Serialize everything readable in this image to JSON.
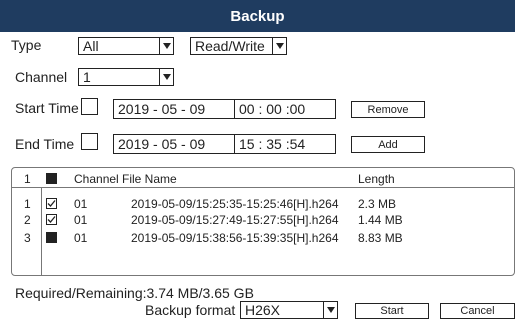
{
  "window": {
    "title": "Backup"
  },
  "filters": {
    "type_label": "Type",
    "type_value": "All",
    "mode_value": "Read/Write",
    "channel_label": "Channel",
    "channel_value": "1"
  },
  "times": {
    "start_label": "Start Time",
    "start_date": "2019 - 05 - 09",
    "start_time": "00 : 00 :00",
    "end_label": "End Time",
    "end_date": "2019 - 05 - 09",
    "end_time": "15 : 35 :54",
    "remove_label": "Remove",
    "add_label": "Add"
  },
  "table": {
    "header_index": "1",
    "columns": [
      "Channel",
      "File Name",
      "Length"
    ],
    "rows": [
      {
        "index": "1",
        "checked": true,
        "channel": "01",
        "file": "2019-05-09/15:25:35-15:25:46[H].h264",
        "length": "2.3 MB"
      },
      {
        "index": "2",
        "checked": true,
        "channel": "01",
        "file": "2019-05-09/15:27:49-15:27:55[H].h264",
        "length": "1.44 MB"
      },
      {
        "index": "3",
        "checked": false,
        "channel": "01",
        "file": "2019-05-09/15:38:56-15:39:35[H].h264",
        "length": "8.83 MB"
      }
    ]
  },
  "footer": {
    "required_remaining": "Required/Remaining:3.74 MB/3.65 GB",
    "backup_format_label": "Backup format",
    "backup_format_value": "H26X",
    "start_label": "Start",
    "cancel_label": "Cancel"
  }
}
